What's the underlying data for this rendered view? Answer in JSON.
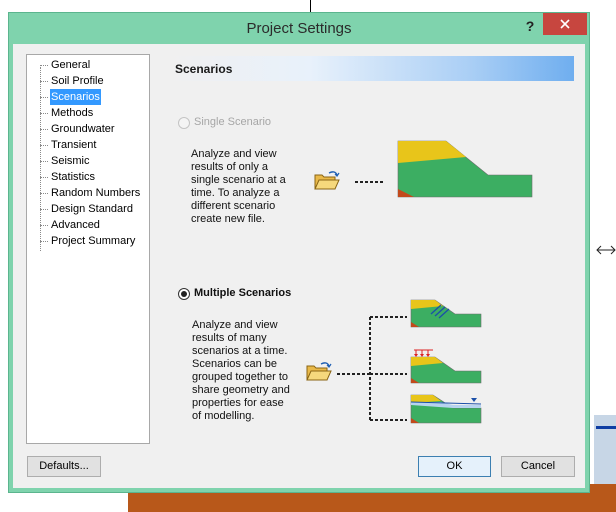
{
  "dialog": {
    "title": "Project Settings",
    "help": "?",
    "accent_color": "#7fd3ad",
    "close_color": "#c7463f"
  },
  "sidebar": {
    "items": [
      {
        "label": "General"
      },
      {
        "label": "Soil Profile"
      },
      {
        "label": "Scenarios",
        "selected": true
      },
      {
        "label": "Methods"
      },
      {
        "label": "Groundwater"
      },
      {
        "label": "Transient"
      },
      {
        "label": "Seismic"
      },
      {
        "label": "Statistics"
      },
      {
        "label": "Random Numbers"
      },
      {
        "label": "Design Standard"
      },
      {
        "label": "Advanced"
      },
      {
        "label": "Project Summary"
      }
    ]
  },
  "panel": {
    "title": "Scenarios",
    "single": {
      "label": "Single Scenario",
      "enabled": false,
      "checked": false,
      "desc": [
        "Analyze and view",
        "results of only a",
        "single scenario at a",
        "time. To analyze a",
        "different scenario",
        "create new file."
      ]
    },
    "multiple": {
      "label": "Multiple Scenarios",
      "checked": true,
      "desc": [
        "Analyze and view",
        "results of many",
        "scenarios at a time.",
        "Scenarios can be",
        "grouped together to",
        "share geometry and",
        "properties for ease",
        "of modelling."
      ]
    }
  },
  "buttons": {
    "defaults": "Defaults...",
    "ok": "OK",
    "cancel": "Cancel"
  }
}
